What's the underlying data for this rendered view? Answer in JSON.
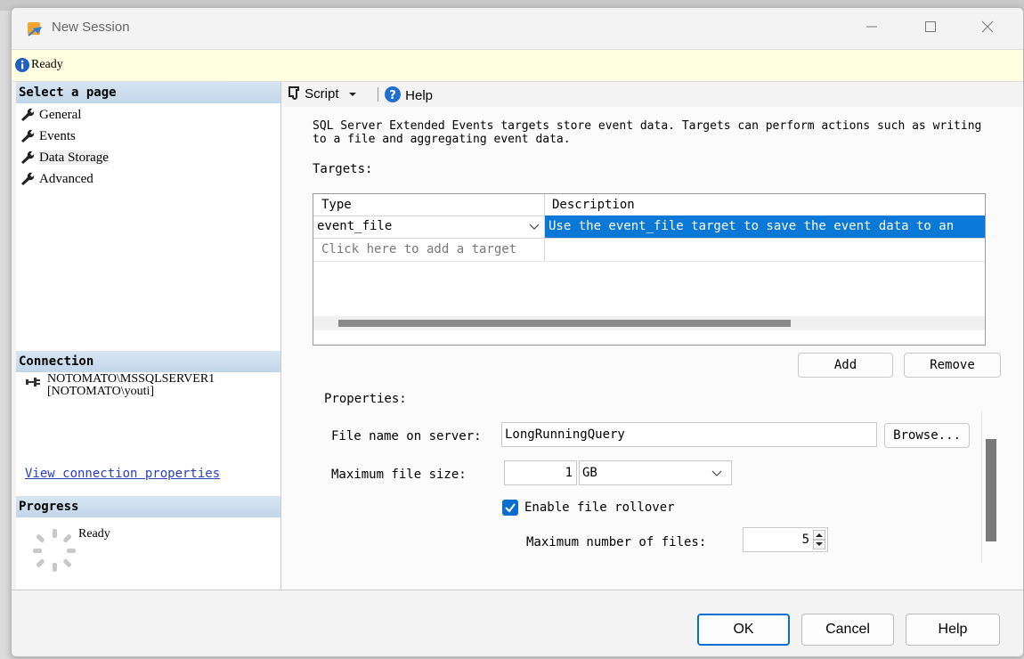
{
  "window": {
    "title": "New Session"
  },
  "status": {
    "text": "Ready"
  },
  "sidebar": {
    "select_page_header": "Select a page",
    "pages": [
      {
        "label": "General"
      },
      {
        "label": "Events"
      },
      {
        "label": "Data Storage",
        "selected": true
      },
      {
        "label": "Advanced"
      }
    ],
    "connection_header": "Connection",
    "connection_server": "NOTOMATO\\MSSQLSERVER1",
    "connection_user": "[NOTOMATO\\youti]",
    "view_connection_link": "View connection properties",
    "progress_header": "Progress",
    "progress_status": "Ready"
  },
  "toolbar": {
    "script_label": "Script",
    "help_label": "Help"
  },
  "main": {
    "description": "SQL Server Extended Events targets store event data. Targets can perform actions such as writing to a file and aggregating event data.",
    "targets_label": "Targets:",
    "targets_grid": {
      "columns": [
        "Type",
        "Description"
      ],
      "rows": [
        {
          "type": "event_file",
          "description": "Use the event_file target to save the event data to an"
        }
      ],
      "add_row_prompt": "Click here to add a target"
    },
    "add_button": "Add",
    "remove_button": "Remove",
    "properties_label": "Properties:",
    "file_name_label": "File name on server:",
    "file_name_value": "LongRunningQuery",
    "browse_button": "Browse...",
    "max_file_size_label": "Maximum file size:",
    "max_file_size_value": "1",
    "max_file_size_unit": "GB",
    "enable_rollover_label": "Enable file rollover",
    "enable_rollover_checked": true,
    "max_files_label": "Maximum number of files:",
    "max_files_value": "5"
  },
  "footer": {
    "ok": "OK",
    "cancel": "Cancel",
    "help": "Help"
  },
  "colors": {
    "accent": "#0a78d7",
    "status_bg": "#fffee0",
    "header_bg": "#c9dbee",
    "link": "#2b3fb8"
  }
}
